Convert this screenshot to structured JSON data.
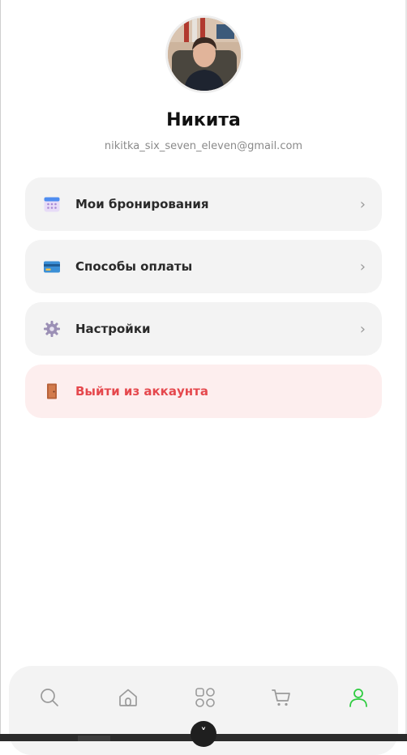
{
  "profile": {
    "name": "Никита",
    "email": "nikitka_six_seven_eleven@gmail.com"
  },
  "menu": {
    "bookings": {
      "label": "Мои бронирования",
      "icon": "calendar-icon"
    },
    "payment": {
      "label": "Способы оплаты",
      "icon": "credit-card-icon"
    },
    "settings": {
      "label": "Настройки",
      "icon": "gear-icon"
    },
    "logout": {
      "label": "Выйти из аккаунта",
      "icon": "door-icon"
    },
    "chevron": "›"
  },
  "bottom_nav": {
    "items": [
      "search",
      "home",
      "catalog",
      "cart",
      "profile"
    ],
    "active": "profile",
    "active_color": "#2ecc40"
  },
  "close_button": {
    "glyph": "˅"
  },
  "colors": {
    "logout_text": "#e5484d",
    "logout_bg": "#fdeeee",
    "card_bg": "#f3f3f3"
  }
}
